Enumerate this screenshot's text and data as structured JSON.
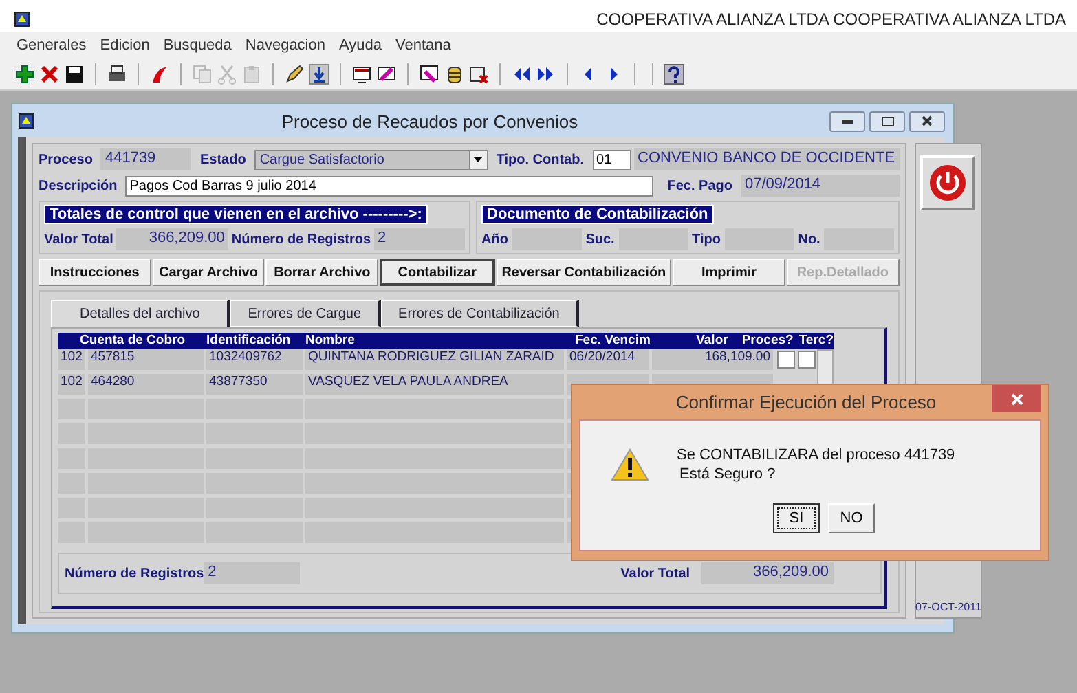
{
  "app": {
    "title": "COOPERATIVA ALIANZA LTDA COOPERATIVA ALIANZA LTDA"
  },
  "menu": [
    "Generales",
    "Edicion",
    "Busqueda",
    "Navegacion",
    "Ayuda",
    "Ventana"
  ],
  "toolbar": [
    {
      "kind": "add",
      "disabled": false
    },
    {
      "kind": "delete",
      "disabled": false
    },
    {
      "kind": "save",
      "disabled": false
    },
    {
      "kind": "sep"
    },
    {
      "kind": "print",
      "disabled": false
    },
    {
      "kind": "sep"
    },
    {
      "kind": "acrobat",
      "disabled": false
    },
    {
      "kind": "sep"
    },
    {
      "kind": "copy",
      "disabled": true
    },
    {
      "kind": "cut",
      "disabled": true
    },
    {
      "kind": "paste",
      "disabled": true
    },
    {
      "kind": "sep"
    },
    {
      "kind": "pencil",
      "disabled": false
    },
    {
      "kind": "download",
      "disabled": false
    },
    {
      "kind": "sep"
    },
    {
      "kind": "screen",
      "disabled": false
    },
    {
      "kind": "marker",
      "disabled": false
    },
    {
      "kind": "sep"
    },
    {
      "kind": "find",
      "disabled": false
    },
    {
      "kind": "database",
      "disabled": false
    },
    {
      "kind": "remove",
      "disabled": false
    },
    {
      "kind": "sep"
    },
    {
      "kind": "first",
      "disabled": false
    },
    {
      "kind": "last",
      "disabled": false
    },
    {
      "kind": "sep"
    },
    {
      "kind": "prev",
      "disabled": false
    },
    {
      "kind": "next",
      "disabled": false
    },
    {
      "kind": "sep"
    },
    {
      "kind": "sep"
    },
    {
      "kind": "help",
      "disabled": false
    }
  ],
  "window": {
    "title": "Proceso de Recaudos por Convenios"
  },
  "form": {
    "proceso_label": "Proceso",
    "proceso": "441739",
    "estado_label": "Estado",
    "estado": "Cargue Satisfactorio",
    "tipo_label": "Tipo. Contab.",
    "tipo": "01",
    "tipo_name": "CONVENIO BANCO DE OCCIDENTE",
    "descripcion_label": "Descripción",
    "descripcion": "Pagos Cod Barras 9 julio 2014",
    "fec_pago_label": "Fec. Pago",
    "fec_pago": "07/09/2014"
  },
  "totales": {
    "title": "Totales de control que vienen en el archivo --------->:",
    "valor_label": "Valor Total",
    "valor": "366,209.00",
    "registros_label": "Número de Registros",
    "registros": "2"
  },
  "documento": {
    "title": "Documento de Contabilización",
    "labels": [
      "Año",
      "Suc.",
      "Tipo",
      "No."
    ]
  },
  "buttons": [
    {
      "label": "Instrucciones",
      "disabled": false,
      "focused": false
    },
    {
      "label": "Cargar Archivo",
      "disabled": false,
      "focused": false
    },
    {
      "label": "Borrar Archivo",
      "disabled": false,
      "focused": false
    },
    {
      "label": "Contabilizar",
      "disabled": false,
      "focused": true
    },
    {
      "label": "Reversar Contabilización",
      "disabled": false,
      "focused": false
    },
    {
      "label": "Imprimir",
      "disabled": false,
      "focused": false
    },
    {
      "label": "Rep.Detallado",
      "disabled": true,
      "focused": false
    }
  ],
  "tabs": [
    {
      "label": "Detalles del archivo",
      "selected": true
    },
    {
      "label": "Errores de Cargue",
      "selected": false
    },
    {
      "label": "Errores de Contabilización",
      "selected": false
    }
  ],
  "table": {
    "columns": [
      "Cuenta de Cobro",
      "Identificación",
      "Nombre",
      "Fec. Vencim",
      "Valor",
      "Proces?",
      "Terc?"
    ],
    "rows": [
      {
        "prefix": "102",
        "cuenta": "457815",
        "identificacion": "1032409762",
        "nombre": "QUINTANA RODRIGUEZ GILIAN ZARAID",
        "fec": "06/20/2014",
        "valor": "168,109.00",
        "proces": false,
        "terc": false
      },
      {
        "prefix": "102",
        "cuenta": "464280",
        "identificacion": "43877350",
        "nombre": "VASQUEZ VELA PAULA ANDREA"
      }
    ]
  },
  "footer": {
    "registros_label": "Número de Registros",
    "registros": "2",
    "valor_label": "Valor Total",
    "valor": "366,209.00"
  },
  "side": {
    "date": "07-OCT-2011"
  },
  "dialog": {
    "title": "Confirmar Ejecución del Proceso",
    "message": "Se CONTABILIZARA del proceso 441739",
    "question": "Está Seguro ?",
    "buttons": [
      {
        "label": "SI",
        "focused": true
      },
      {
        "label": "NO",
        "focused": false
      }
    ]
  }
}
